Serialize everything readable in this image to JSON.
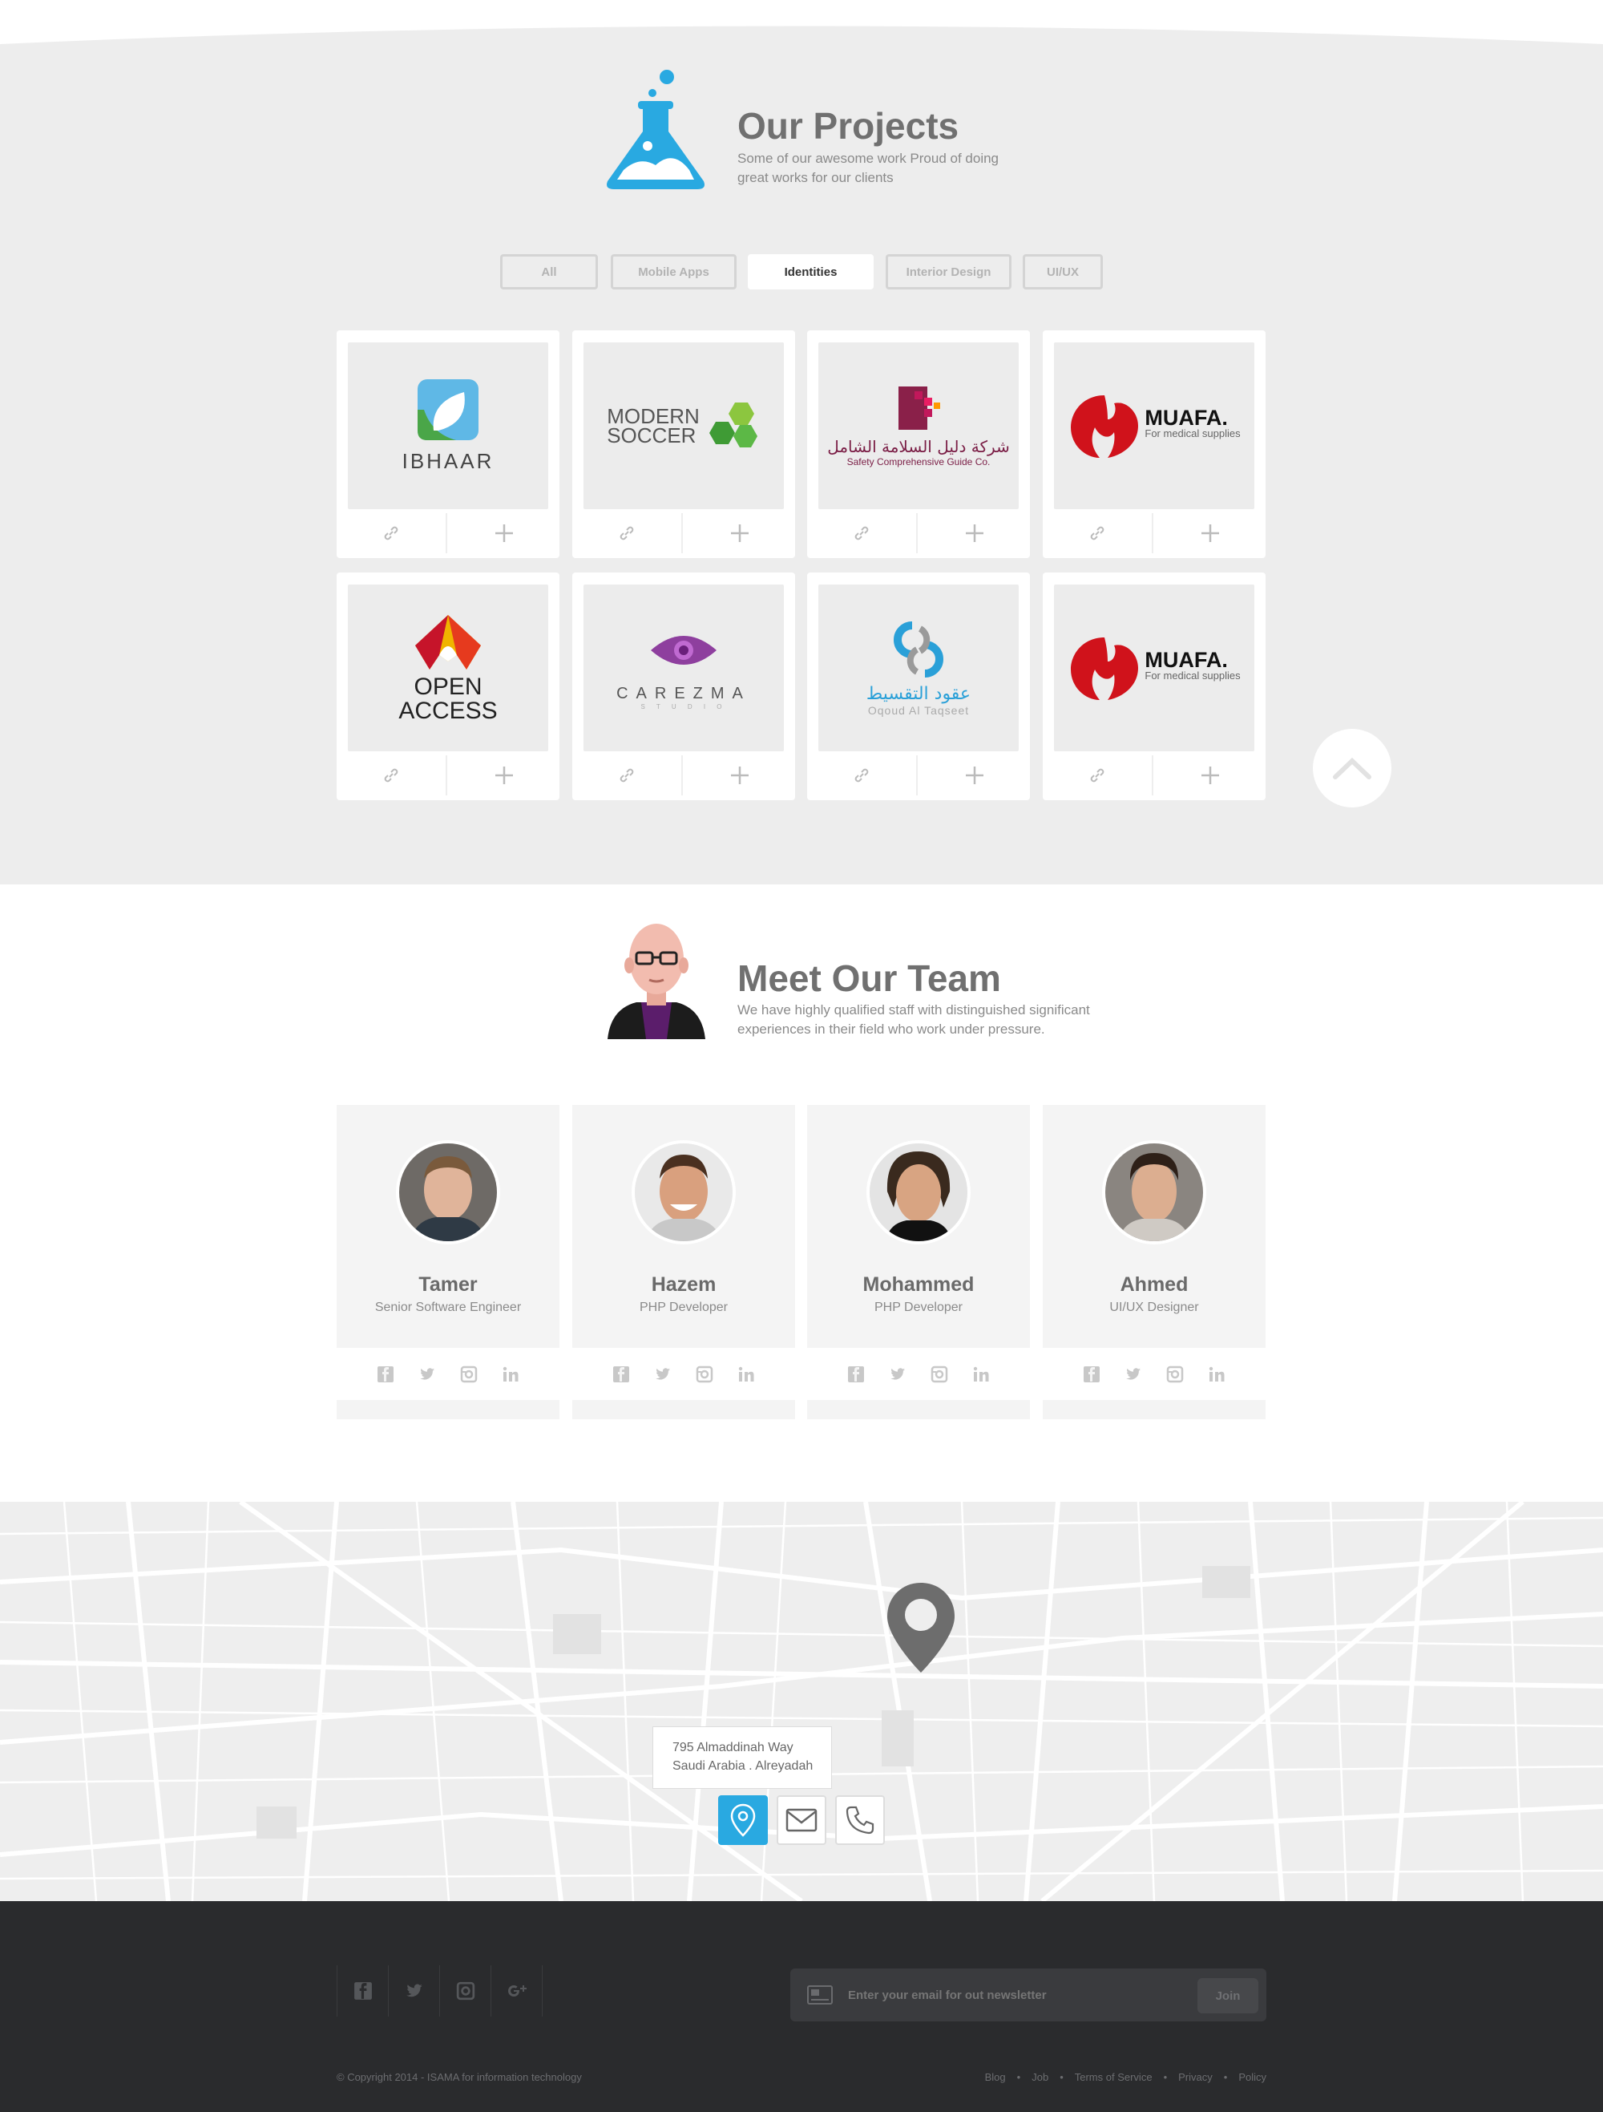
{
  "colors": {
    "accent": "#29a9e1",
    "page_bg": "#ededed",
    "footer_bg": "#2a2b2d"
  },
  "projects": {
    "title": "Our Projects",
    "subtitle": "Some of our awesome work Proud of doing great works for our clients",
    "icon": "flask-icon",
    "filters": [
      {
        "label": "All",
        "active": false
      },
      {
        "label": "Mobile Apps",
        "active": false
      },
      {
        "label": "Identities",
        "active": true
      },
      {
        "label": "Interior Design",
        "active": false
      },
      {
        "label": "UI/UX",
        "active": false
      }
    ],
    "items": [
      {
        "logo_text": "IBHAAR",
        "logo_sub": ""
      },
      {
        "logo_text": "MODERN",
        "logo_sub": "SOCCER"
      },
      {
        "logo_text": "شركة دليل السلامة الشامل",
        "logo_sub": "Safety Comprehensive Guide Co."
      },
      {
        "logo_text": "MUAFA.",
        "logo_sub": "For medical supplies"
      },
      {
        "logo_text": "OPEN",
        "logo_sub": "ACCESS"
      },
      {
        "logo_text": "CAREZMA",
        "logo_sub": "S T U D I O"
      },
      {
        "logo_text": "عقود التقسيط",
        "logo_sub": "Oqoud Al Taqseet"
      },
      {
        "logo_text": "MUAFA.",
        "logo_sub": "For medical supplies"
      }
    ]
  },
  "team": {
    "title": "Meet Our Team",
    "subtitle": "We have highly qualified staff with distinguished significant experiences in their field who work under pressure.",
    "members": [
      {
        "name": "Tamer",
        "role": "Senior Software Engineer"
      },
      {
        "name": "Hazem",
        "role": "PHP Developer"
      },
      {
        "name": "Mohammed",
        "role": "PHP Developer"
      },
      {
        "name": "Ahmed",
        "role": "UI/UX Designer"
      }
    ]
  },
  "map": {
    "address_line1": "795 Almaddinah Way",
    "address_line2": "Saudi Arabia . Alreyadah"
  },
  "footer": {
    "newsletter_placeholder": "Enter your email for out newsletter",
    "join_label": "Join",
    "copyright": "© Copyright 2014 - ISAMA for information technology",
    "links": [
      "Blog",
      "Job",
      "Terms of Service",
      "Privacy",
      "Policy"
    ]
  }
}
